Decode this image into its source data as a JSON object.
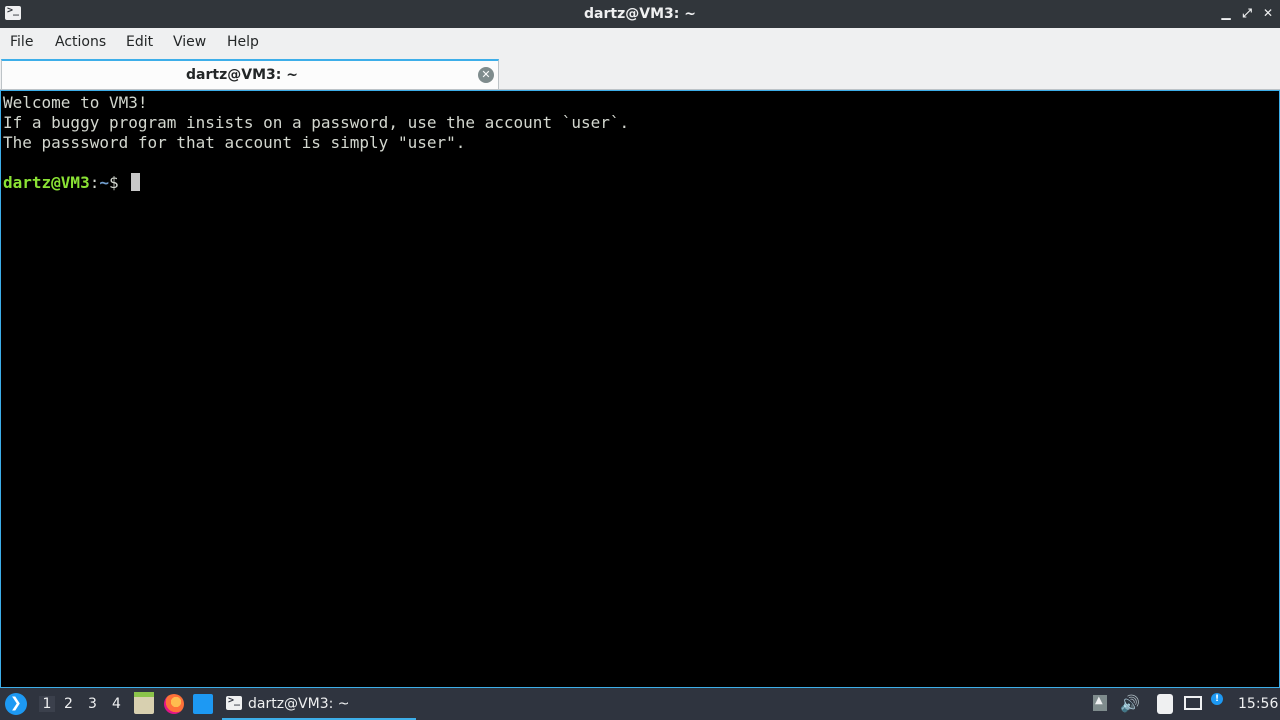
{
  "window": {
    "title": "dartz@VM3: ~",
    "icon": "terminal-icon",
    "controls": {
      "minimize": "▁",
      "maximize": "⤢",
      "close": "✕"
    }
  },
  "menubar": {
    "items": [
      {
        "label": "File"
      },
      {
        "label": "Actions"
      },
      {
        "label": "Edit"
      },
      {
        "label": "View"
      },
      {
        "label": "Help"
      }
    ]
  },
  "tabs": [
    {
      "label": "dartz@VM3: ~",
      "active": true
    }
  ],
  "terminal": {
    "lines": [
      "Welcome to VM3!",
      "If a buggy program insists on a password, use the account `user`.",
      "The passsword for that account is simply \"user\"."
    ],
    "prompt": {
      "user_host": "dartz@VM3",
      "sep": ":",
      "path": "~",
      "symbol": "$"
    },
    "colors": {
      "foreground": "#d3d7cf",
      "user": "#8ae234",
      "path": "#729fcf",
      "background": "#000000"
    }
  },
  "taskbar": {
    "workspaces": [
      "1",
      "2",
      "3",
      "4"
    ],
    "active_workspace": "1",
    "launchers": [
      "start-menu-icon",
      "file-manager-icon",
      "firefox-icon",
      "show-desktop-icon"
    ],
    "tasks": [
      {
        "label": "dartz@VM3: ~",
        "icon": "terminal-icon"
      }
    ],
    "tray": [
      "tray-arrow-icon",
      "volume-icon",
      "clipboard-icon",
      "network-icon",
      "info-icon"
    ],
    "clock": "15:56"
  },
  "accent": "#3daee9"
}
